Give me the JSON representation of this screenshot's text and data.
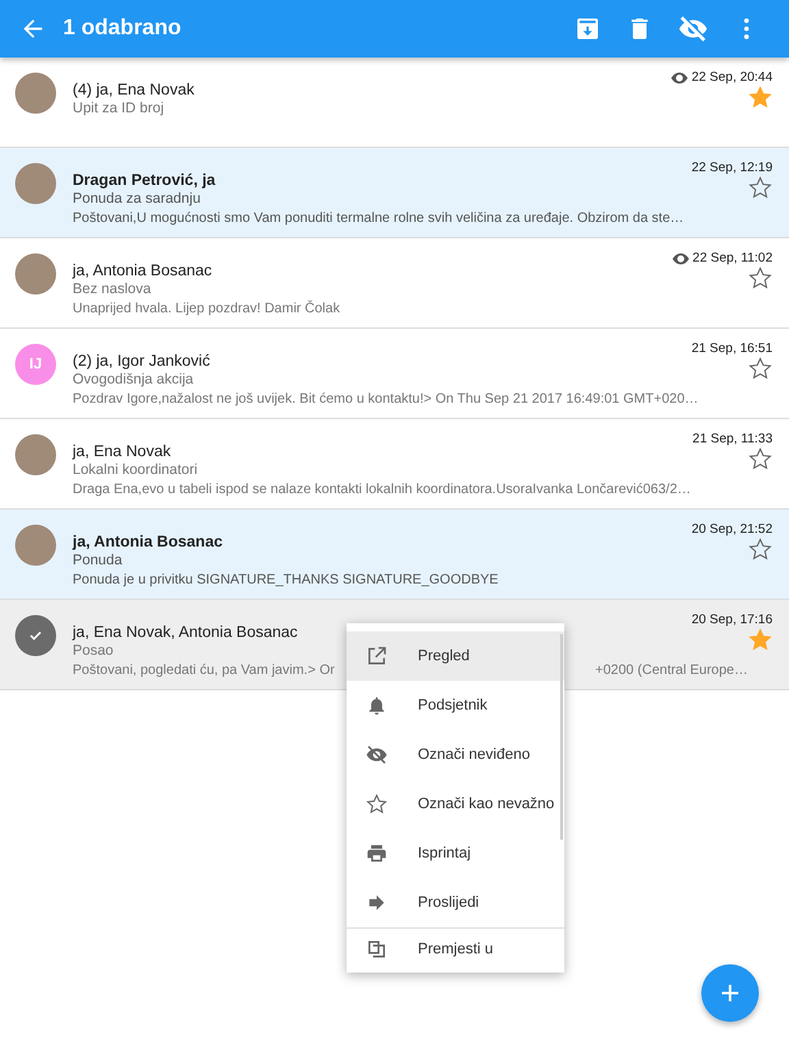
{
  "toolbar": {
    "title": "1 odabrano"
  },
  "messages": [
    {
      "participants": "(4) ja, Ena Novak",
      "unread": false,
      "selected": false,
      "seen": true,
      "date": "22 Sep, 20:44",
      "subject": "Upit za ID broj",
      "starred": true,
      "avatar": {
        "kind": "photo"
      }
    },
    {
      "participants": "Dragan Petrović, ja",
      "unread": true,
      "selected": false,
      "seen": false,
      "date": "22 Sep, 12:19",
      "subject": "Ponuda za saradnju",
      "preview": [
        "Poštovani,U mogućnosti smo Vam ponuditi termalne rolne svih veličina za uređaje. Obzirom da ste…"
      ],
      "starred": false,
      "avatar": {
        "kind": "photo"
      }
    },
    {
      "participants": "ja, Antonia Bosanac",
      "unread": false,
      "selected": false,
      "seen": true,
      "date": "22 Sep, 11:02",
      "subject": "Bez naslova",
      "preview": [
        "Unaprijed hvala. Lijep pozdrav! Damir Čolak"
      ],
      "starred": false,
      "avatar": {
        "kind": "photo"
      }
    },
    {
      "participants": "(2) ja, Igor Janković",
      "unread": false,
      "selected": false,
      "seen": false,
      "date": "21 Sep, 16:51",
      "subject": "Ovogodišnja akcija",
      "preview": [
        "Pozdrav Igore,nažalost ne još uvijek. Bit ćemo u kontaktu!> On Thu Sep 21 2017 16:49:01 GMT+020…"
      ],
      "starred": false,
      "avatar": {
        "kind": "initials",
        "text": "IJ",
        "color": "#f98ee8"
      }
    },
    {
      "participants": "ja, Ena Novak",
      "unread": false,
      "selected": false,
      "seen": false,
      "date": "21 Sep, 11:33",
      "subject": "Lokalni koordinatori",
      "preview": [
        "Draga Ena,evo u tabeli ispod se nalaze kontakti lokalnih koordinatora.UsoraIvanka Lončarević063/2…"
      ],
      "starred": false,
      "avatar": {
        "kind": "photo"
      }
    },
    {
      "participants": "ja, Antonia Bosanac",
      "unread": true,
      "selected": false,
      "seen": false,
      "date": "20 Sep, 21:52",
      "subject": "Ponuda",
      "preview": [
        "Ponuda je u privitku SIGNATURE_THANKS   SIGNATURE_GOODBYE"
      ],
      "starred": false,
      "avatar": {
        "kind": "photo"
      }
    },
    {
      "participants": "ja, Ena Novak, Antonia Bosanac",
      "unread": false,
      "selected": true,
      "seen": false,
      "date": "20 Sep, 17:16",
      "subject": "Posao",
      "preview": [
        "Poštovani, pogledati ću, pa Vam javim.> Or",
        "+0200 (Central Europe…"
      ],
      "starred": true,
      "avatar": {
        "kind": "check"
      }
    }
  ],
  "context_menu": [
    {
      "label": "Pregled",
      "kind": "open",
      "selected": true
    },
    {
      "label": "Podsjetnik",
      "kind": "bell",
      "selected": false
    },
    {
      "label": "Označi neviđeno",
      "kind": "unseen",
      "selected": false
    },
    {
      "label": "Označi kao nevažno",
      "kind": "star",
      "selected": false
    },
    {
      "label": "Isprintaj",
      "kind": "print",
      "selected": false
    },
    {
      "label": "Proslijedi",
      "kind": "forward",
      "selected": false
    },
    {
      "label": "Premjesti u",
      "kind": "move",
      "selected": false
    }
  ]
}
